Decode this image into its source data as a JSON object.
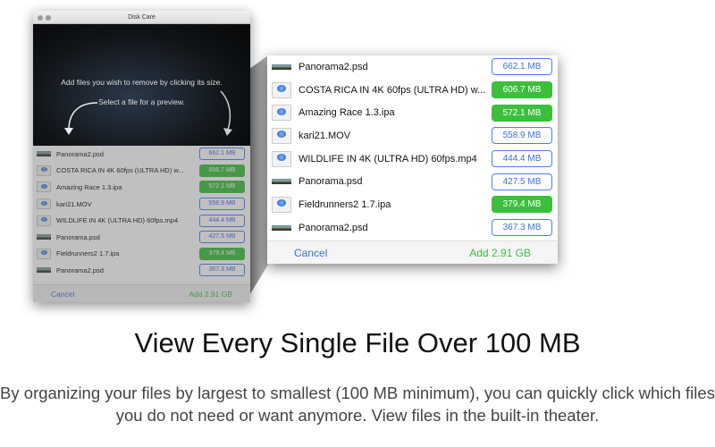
{
  "window": {
    "title": "Disk Care"
  },
  "theater": {
    "hint1": "Add files you wish to remove by clicking its size.",
    "hint2": "Select a file for a preview."
  },
  "files": [
    {
      "name": "Panorama2.psd",
      "size": "662.1 MB",
      "selected": false,
      "icon": "panorama-thumbnail-icon"
    },
    {
      "name": "COSTA RICA IN 4K 60fps (ULTRA HD) w...",
      "size": "606.7 MB",
      "selected": true,
      "icon": "quicktime-file-icon"
    },
    {
      "name": "Amazing Race 1.3.ipa",
      "size": "572.1 MB",
      "selected": true,
      "icon": "ipa-file-icon"
    },
    {
      "name": "kari21.MOV",
      "size": "558.9 MB",
      "selected": false,
      "icon": "quicktime-file-icon"
    },
    {
      "name": "WILDLIFE IN 4K (ULTRA HD) 60fps.mp4",
      "size": "444.4 MB",
      "selected": false,
      "icon": "quicktime-file-icon"
    },
    {
      "name": "Panorama.psd",
      "size": "427.5 MB",
      "selected": false,
      "icon": "panorama-thumbnail-icon"
    },
    {
      "name": "Fieldrunners2 1.7.ipa",
      "size": "379.4 MB",
      "selected": true,
      "icon": "ipa-file-icon"
    },
    {
      "name": "Panorama2.psd",
      "size": "367.3 MB",
      "selected": false,
      "icon": "panorama-thumbnail-icon"
    }
  ],
  "footer": {
    "cancel": "Cancel",
    "add": "Add 2.91 GB"
  },
  "headline": "View Every Single File Over 100 MB",
  "description": "By organizing your files by largest to smallest (100 MB minimum), you can quickly click which files you do not need or want anymore. View files in the built-in theater.",
  "colors": {
    "accent_blue": "#3c6fe0",
    "accent_green": "#3cbf3c"
  }
}
